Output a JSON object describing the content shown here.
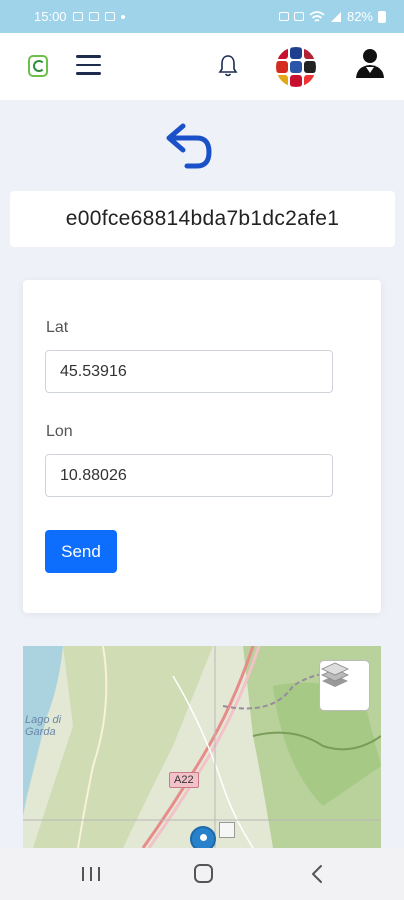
{
  "status_bar": {
    "time": "15:00",
    "battery_percent": "82%",
    "icons": [
      "photo-icon",
      "cast-icon",
      "video-icon",
      "dot-icon",
      "sim-icon",
      "alarm-icon",
      "wifi-icon",
      "signal-icon",
      "battery-icon"
    ]
  },
  "header": {
    "icons": [
      "app-logo-icon",
      "hamburger-menu-icon",
      "bell-icon",
      "language-flags-icon",
      "user-avatar-icon"
    ]
  },
  "device": {
    "id": "e00fce68814bda7b1dc2afe1"
  },
  "form": {
    "lat_label": "Lat",
    "lat_value": "45.53916",
    "lon_label": "Lon",
    "lon_value": "10.88026",
    "send_label": "Send"
  },
  "map": {
    "lake_label_line1": "Lago di",
    "lake_label_line2": "Garda",
    "road_label": "A22",
    "layers_icon": "layers-icon",
    "marker_icon": "map-marker-icon"
  },
  "nav": {
    "icons": [
      "recent-apps-icon",
      "home-icon",
      "back-icon"
    ]
  },
  "colors": {
    "status_bar": "#9fd3ea",
    "primary": "#0d6efd",
    "back_arrow": "#1a50c8",
    "page_bg": "#eef1f8"
  }
}
